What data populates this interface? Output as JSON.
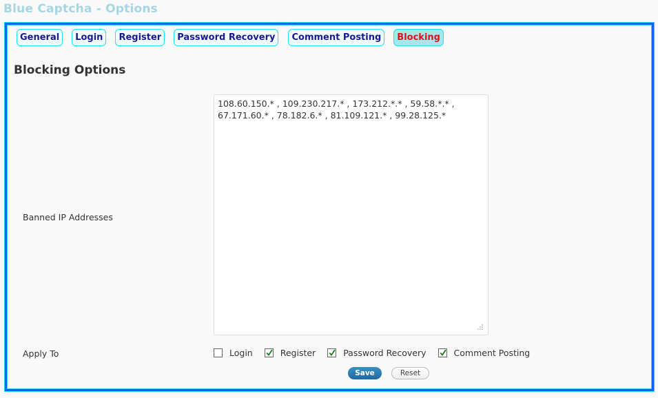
{
  "page": {
    "title": "Blue Captcha - Options"
  },
  "tabs": [
    {
      "label": "General",
      "active": false
    },
    {
      "label": "Login",
      "active": false
    },
    {
      "label": "Register",
      "active": false
    },
    {
      "label": "Password Recovery",
      "active": false
    },
    {
      "label": "Comment Posting",
      "active": false
    },
    {
      "label": "Blocking",
      "active": true
    }
  ],
  "section": {
    "heading": "Blocking Options"
  },
  "banned_ips": {
    "label": "Banned IP Addresses",
    "value": "108.60.150.* , 109.230.217.* , 173.212.*.* , 59.58.*.* , 67.171.60.* , 78.182.6.* , 81.109.121.* , 99.28.125.*"
  },
  "apply_to": {
    "label": "Apply To",
    "options": [
      {
        "label": "Login",
        "checked": false
      },
      {
        "label": "Register",
        "checked": true
      },
      {
        "label": "Password Recovery",
        "checked": true
      },
      {
        "label": "Comment Posting",
        "checked": true
      }
    ]
  },
  "actions": {
    "save_label": "Save",
    "reset_label": "Reset"
  },
  "colors": {
    "title": "#a7d6e3",
    "panel_border": "#1a5cff",
    "tab_border": "#16e6f2",
    "tab_text": "#1a1a8a",
    "active_tab_text": "#e0101a",
    "active_tab_bg": "#a8e6ee",
    "save_button": "#2a7db5",
    "checkmark": "#1a7a1a"
  }
}
